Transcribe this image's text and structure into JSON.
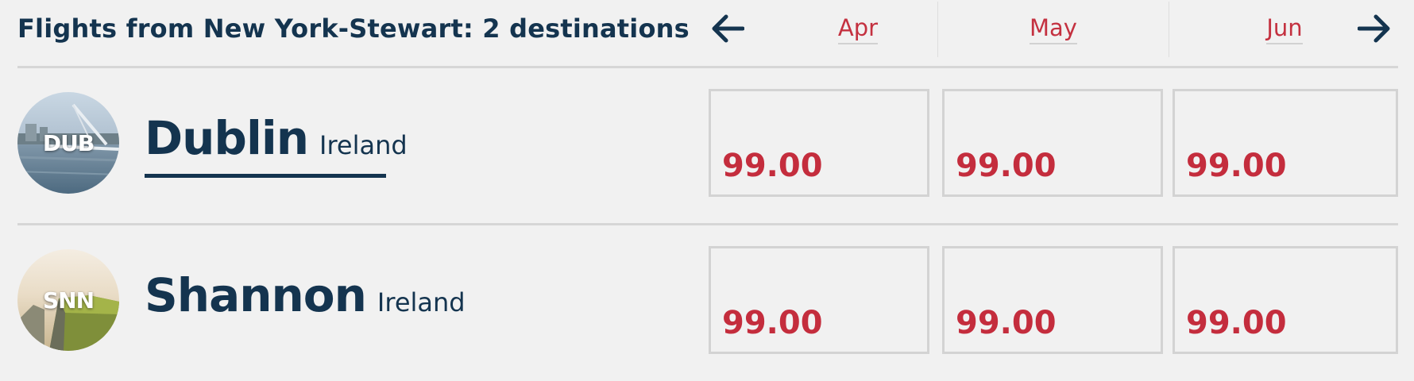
{
  "header": {
    "title": "Flights from New York-Stewart: 2 destinations"
  },
  "months": [
    {
      "label": "Apr"
    },
    {
      "label": "May"
    },
    {
      "label": "Jun"
    }
  ],
  "destinations": [
    {
      "code": "DUB",
      "city": "Dublin",
      "country": "Ireland",
      "prices": [
        "99.00",
        "99.00",
        "99.00"
      ]
    },
    {
      "code": "SNN",
      "city": "Shannon",
      "country": "Ireland",
      "prices": [
        "99.00",
        "99.00",
        "99.00"
      ]
    }
  ],
  "colors": {
    "navy": "#14344f",
    "price_red": "#c42d3d",
    "month_red": "#c43140",
    "background": "#f1f1f1",
    "border_gray": "#d3d3d3"
  },
  "icons": {
    "prev": "arrow-left-icon",
    "next": "arrow-right-icon"
  }
}
